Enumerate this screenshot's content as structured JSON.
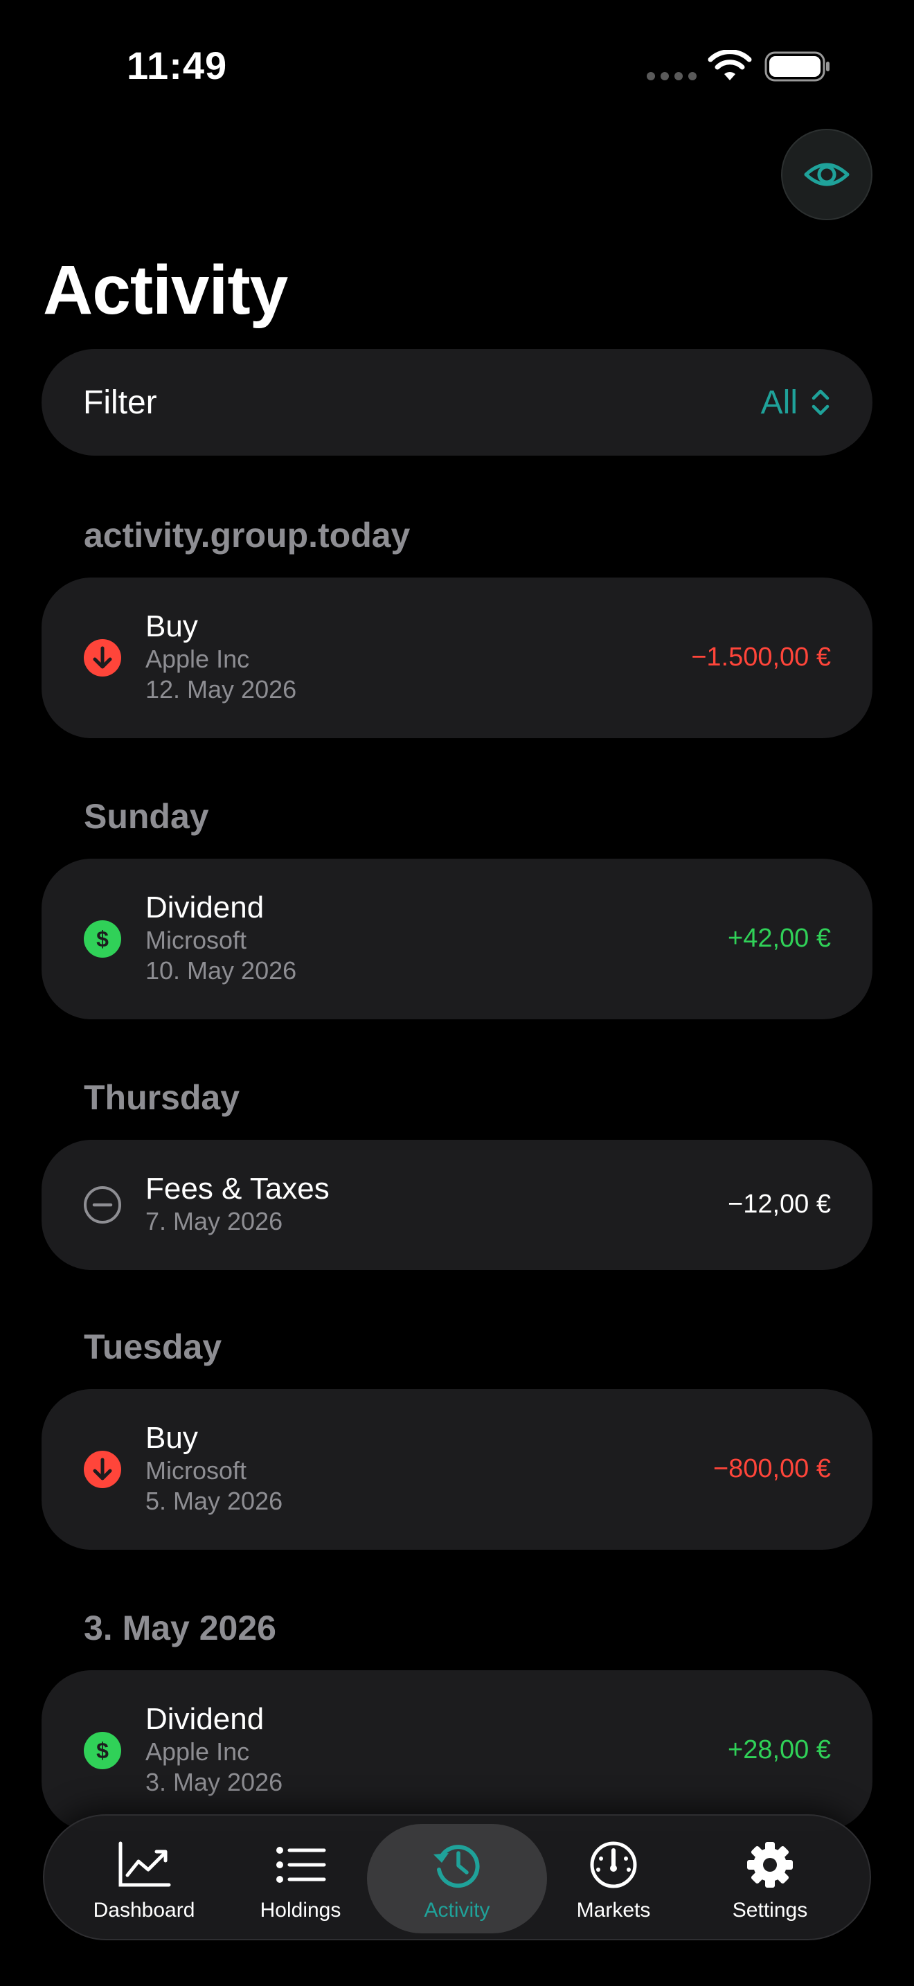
{
  "status": {
    "time": "11:49"
  },
  "header": {
    "title": "Activity",
    "eye_icon": "eye-icon"
  },
  "filter": {
    "label": "Filter",
    "value": "All"
  },
  "groups": [
    {
      "header": "activity.group.today",
      "items": [
        {
          "title": "Buy",
          "subtitle": "Apple Inc",
          "date": "12. May 2026",
          "amount": "−1.500,00 €",
          "kind": "buy"
        }
      ]
    },
    {
      "header": "Sunday",
      "items": [
        {
          "title": "Dividend",
          "subtitle": "Microsoft",
          "date": "10. May 2026",
          "amount": "+42,00 €",
          "kind": "dividend"
        }
      ]
    },
    {
      "header": "Thursday",
      "items": [
        {
          "title": "Fees & Taxes",
          "date": "7. May 2026",
          "amount": "−12,00 €",
          "kind": "fee"
        }
      ]
    },
    {
      "header": "Tuesday",
      "items": [
        {
          "title": "Buy",
          "subtitle": "Microsoft",
          "date": "5. May 2026",
          "amount": "−800,00 €",
          "kind": "buy"
        }
      ]
    },
    {
      "header": "3. May 2026",
      "items": [
        {
          "title": "Dividend",
          "subtitle": "Apple Inc",
          "date": "3. May 2026",
          "amount": "+28,00 €",
          "kind": "dividend"
        }
      ]
    }
  ],
  "tabs": [
    {
      "label": "Dashboard",
      "icon": "chart-line-icon"
    },
    {
      "label": "Holdings",
      "icon": "list-icon"
    },
    {
      "label": "Activity",
      "icon": "clock-arrow-icon",
      "active": true
    },
    {
      "label": "Markets",
      "icon": "gauge-icon"
    },
    {
      "label": "Settings",
      "icon": "gear-icon"
    }
  ],
  "colors": {
    "accent": "#1fa29a",
    "negative": "#ff453a",
    "positive": "#30d158",
    "card": "#1c1c1e",
    "secondary_text": "#8e8e93"
  }
}
